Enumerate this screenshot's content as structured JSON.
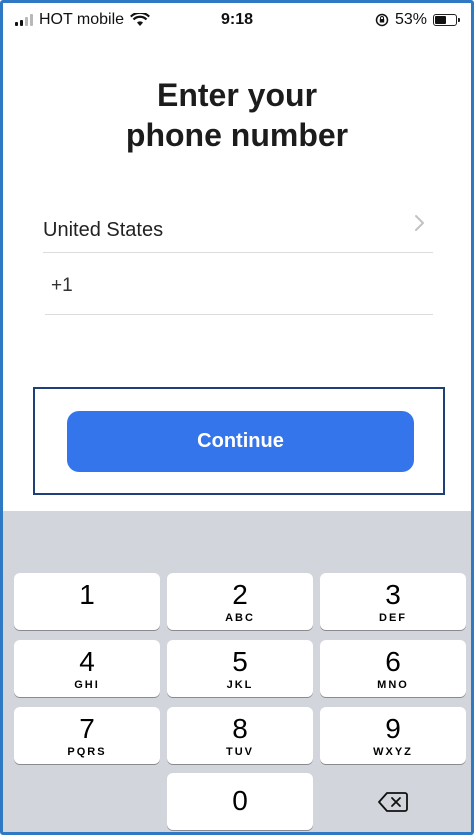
{
  "status_bar": {
    "carrier": "HOT mobile",
    "time": "9:18",
    "battery": "53%"
  },
  "title_line1": "Enter your",
  "title_line2": "phone number",
  "country": {
    "label": "United States",
    "icon": "chevron-right-icon"
  },
  "phone": {
    "code": "+1"
  },
  "continue_label": "Continue",
  "keypad": {
    "keys": [
      {
        "num": "1",
        "letters": ""
      },
      {
        "num": "2",
        "letters": "ABC"
      },
      {
        "num": "3",
        "letters": "DEF"
      },
      {
        "num": "4",
        "letters": "GHI"
      },
      {
        "num": "5",
        "letters": "JKL"
      },
      {
        "num": "6",
        "letters": "MNO"
      },
      {
        "num": "7",
        "letters": "PQRS"
      },
      {
        "num": "8",
        "letters": "TUV"
      },
      {
        "num": "9",
        "letters": "WXYZ"
      },
      {
        "num": "0",
        "letters": ""
      }
    ],
    "delete_icon": "backspace-icon"
  },
  "colors": {
    "accent": "#3575ec",
    "highlight_border": "#1f3f7a",
    "keypad_bg": "#d2d5db"
  }
}
